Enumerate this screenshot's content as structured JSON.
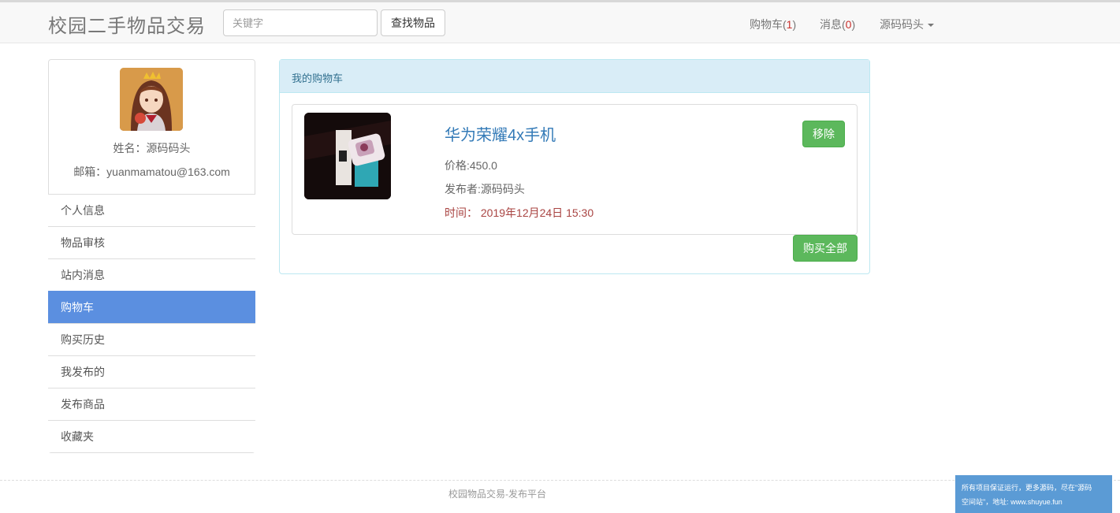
{
  "navbar": {
    "brand": "校园二手物品交易",
    "search_placeholder": "关键字",
    "search_button": "查找物品",
    "cart_label": "购物车(",
    "cart_count": "1",
    "messages_label": "消息(",
    "messages_count": "0",
    "close_paren": ")",
    "user_menu": "源码码头"
  },
  "profile": {
    "name": "姓名：源码码头",
    "email": "邮箱：yuanmamatou@163.com"
  },
  "menu": [
    {
      "label": "个人信息"
    },
    {
      "label": "物品审核"
    },
    {
      "label": "站内消息"
    },
    {
      "label": "购物车"
    },
    {
      "label": "购买历史"
    },
    {
      "label": "我发布的"
    },
    {
      "label": "发布商品"
    },
    {
      "label": "收藏夹"
    }
  ],
  "active_menu": "购物车",
  "cart": {
    "heading": "我的购物车",
    "items": [
      {
        "title": "华为荣耀4x手机",
        "price": "价格:450.0",
        "publisher": "发布者:源码码头",
        "time": "时间： 2019年12月24日 15:30",
        "remove_label": "移除"
      }
    ],
    "buy_all_label": "购买全部"
  },
  "footer": {
    "text": "校园物品交易-发布平台"
  },
  "banner": {
    "line1": "所有项目保证运行，更多源码，尽在\"源码",
    "line2": "空间站\"，地址: www.shuyue.fun"
  },
  "colors": {
    "navbar_bg": "#f8f8f8",
    "active_menu_bg": "#5b8fe0",
    "panel_head_bg": "#d9edf7",
    "success_button": "#5cb85c",
    "link_title": "#337ab7",
    "time_text": "#a94442",
    "count_text": "#c9302c",
    "banner_bg": "#5b9bd5"
  }
}
